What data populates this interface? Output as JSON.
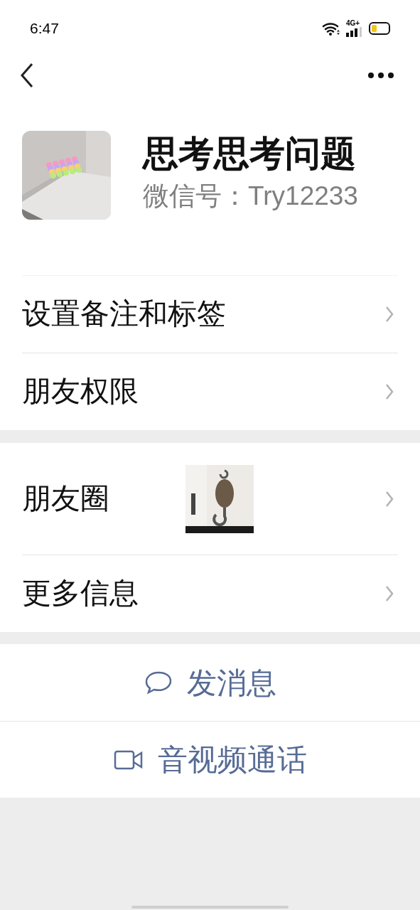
{
  "status_bar": {
    "time": "6:47",
    "network": "4G+"
  },
  "profile": {
    "name": "思考思考问题",
    "wechat_id": "微信号：Try12233"
  },
  "groups": [
    {
      "rows": [
        {
          "label": "设置备注和标签",
          "kind": "plain"
        },
        {
          "label": "朋友权限",
          "kind": "plain"
        }
      ]
    },
    {
      "rows": [
        {
          "label": "朋友圈",
          "kind": "photos"
        },
        {
          "label": "更多信息",
          "kind": "plain"
        }
      ]
    }
  ],
  "actions": [
    {
      "label": "发消息",
      "kind": "message"
    },
    {
      "label": "音视频通话",
      "kind": "call"
    }
  ]
}
